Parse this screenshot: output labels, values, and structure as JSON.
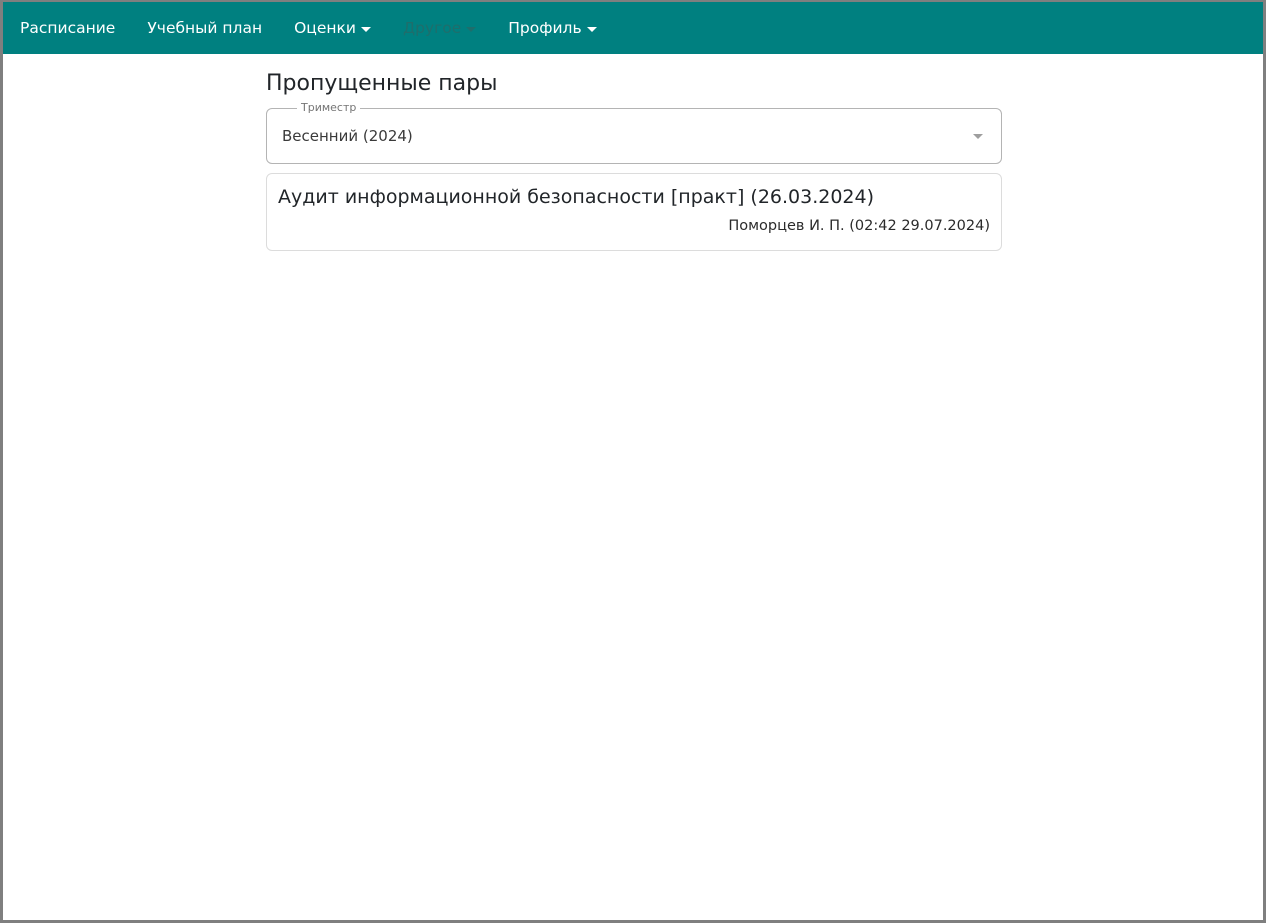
{
  "nav": {
    "items": [
      {
        "label": "Расписание",
        "dropdown": false,
        "disabled": false
      },
      {
        "label": "Учебный план",
        "dropdown": false,
        "disabled": false
      },
      {
        "label": "Оценки",
        "dropdown": true,
        "disabled": false
      },
      {
        "label": "Другое",
        "dropdown": true,
        "disabled": true
      },
      {
        "label": "Профиль",
        "dropdown": true,
        "disabled": false
      }
    ]
  },
  "page": {
    "title": "Пропущенные пары"
  },
  "term_select": {
    "legend": "Триместр",
    "value": "Весенний (2024)"
  },
  "absences": [
    {
      "title": "Аудит информационной безопасности [практ] (26.03.2024)",
      "meta": "Поморцев И. П. (02:42 29.07.2024)"
    }
  ],
  "colors": {
    "navbar_bg": "#008080",
    "nav_text": "#ffffff",
    "nav_disabled": "#1e6e6c"
  }
}
